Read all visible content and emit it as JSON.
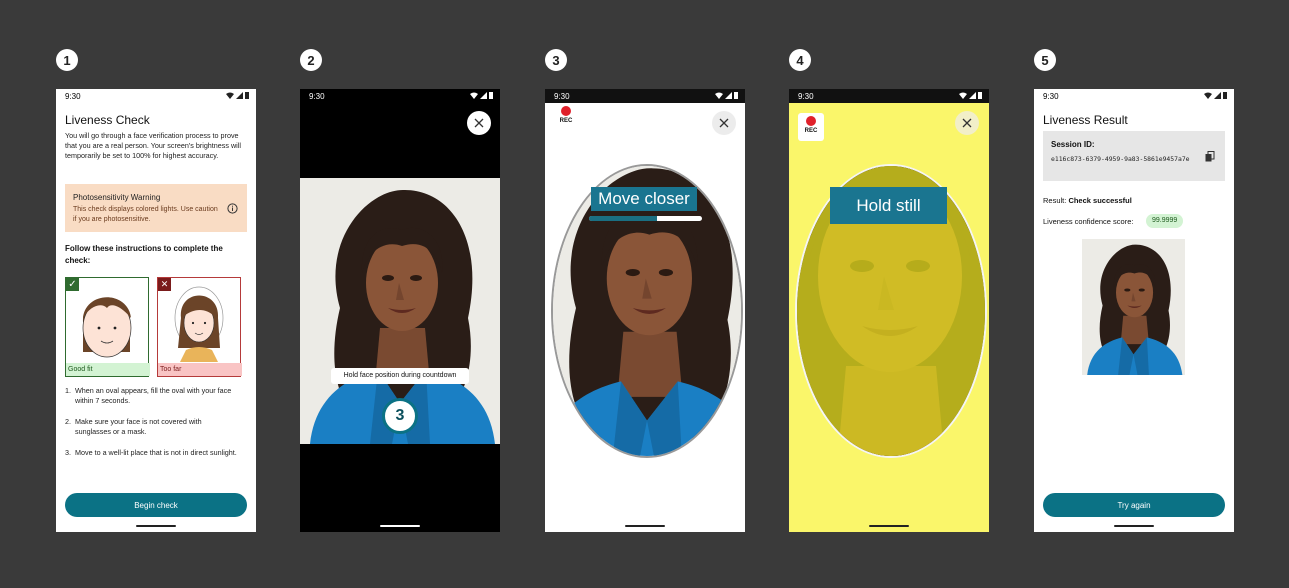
{
  "steps": [
    "1",
    "2",
    "3",
    "4",
    "5"
  ],
  "status_time": "9:30",
  "screen1": {
    "title": "Liveness Check",
    "intro": "You will go through a face verification process to prove that you are a real person. Your screen's brightness will temporarily be set to 100% for highest accuracy.",
    "warning_title": "Photosensitivity Warning",
    "warning_text": "This check displays colored lights. Use caution if you are photosensitive.",
    "instructions_heading": "Follow these instructions to complete the check:",
    "good_label": "Good fit",
    "bad_label": "Too far",
    "instructions": [
      "When an oval appears, fill the oval with your face within 7 seconds.",
      "Make sure your face is not covered with sunglasses or a mask.",
      "Move to a well-lit place that is not in direct sunlight."
    ],
    "numbers": [
      "1.",
      "2.",
      "3."
    ],
    "button": "Begin check"
  },
  "screen2": {
    "countdown_hint": "Hold face position during countdown",
    "countdown": "3"
  },
  "screen3": {
    "rec": "REC",
    "prompt": "Move closer",
    "progress": 0.6
  },
  "screen4": {
    "rec": "REC",
    "prompt": "Hold still"
  },
  "screen5": {
    "title": "Liveness Result",
    "session_label": "Session ID:",
    "session_id": "e116c873-6379-4959-9a83-5861e9457a7e",
    "result_label": "Result:",
    "result_value": "Check successful",
    "score_label": "Liveness confidence score:",
    "score_value": "99.9999",
    "button": "Try again"
  },
  "colors": {
    "accent": "#0b7285",
    "warning_bg": "#f9dcc4",
    "good_bg": "#d3f3d3",
    "bad_bg": "#f9c4c4",
    "flash_yellow": "#faf66a",
    "rec_red": "#e0202a"
  }
}
